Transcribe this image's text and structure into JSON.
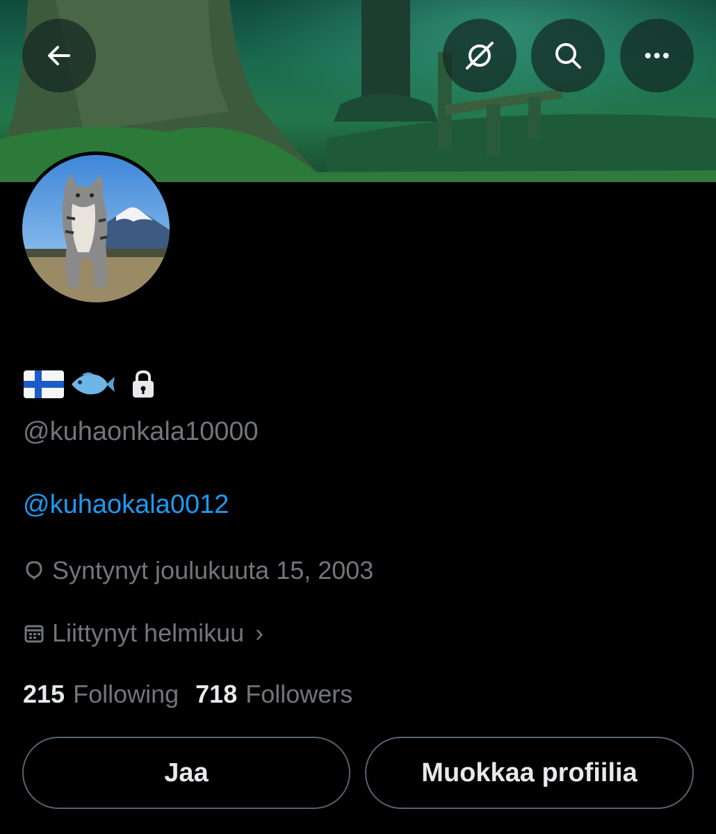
{
  "header": {
    "back_icon": "arrow-left-icon",
    "actions": [
      {
        "icon": "grok-slash-icon"
      },
      {
        "icon": "search-icon"
      },
      {
        "icon": "more-icon"
      }
    ]
  },
  "profile": {
    "display_name_emojis": [
      "finland-flag-emoji",
      "fish-emoji"
    ],
    "protected_icon": "lock-icon",
    "handle": "@kuhaonkala10000",
    "bio": "@kuhaokala0012",
    "birth": {
      "icon": "balloon-icon",
      "text": "Syntynyt joulukuuta 15, 2003"
    },
    "joined": {
      "icon": "calendar-icon",
      "text": "Liittynyt helmikuu",
      "chevron": "›"
    },
    "following_count": "215",
    "following_label": "Following",
    "followers_count": "718",
    "followers_label": "Followers"
  },
  "buttons": {
    "share": "Jaa",
    "edit_profile": "Muokkaa profiilia"
  },
  "colors": {
    "background": "#000000",
    "text": "#e7e9ea",
    "secondary": "#71767b",
    "link": "#1d9bf0",
    "border": "#536471"
  }
}
